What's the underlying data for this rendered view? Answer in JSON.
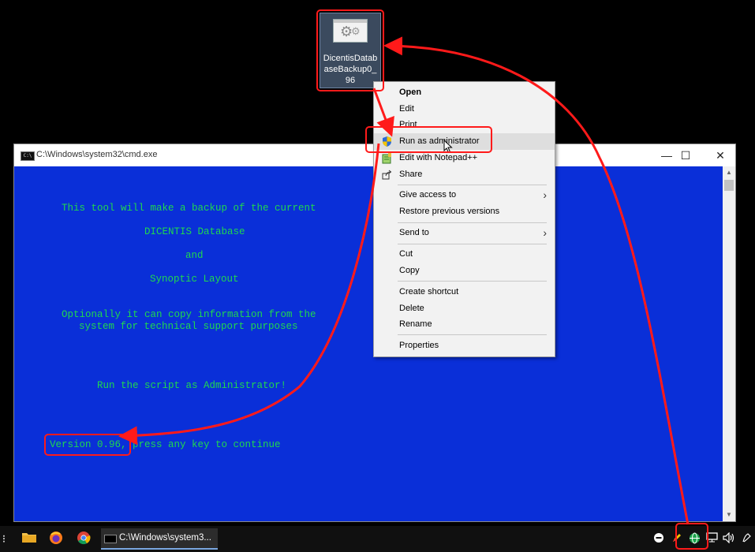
{
  "desktop_icon": {
    "label": "DicentisDatabaseBackup0_96"
  },
  "cmd_window": {
    "title": "C:\\Windows\\system32\\cmd.exe",
    "controls": {
      "minimize": "—",
      "maximize": "☐",
      "close": "✕"
    },
    "lines": [
      "This tool will make a backup of the current",
      "DICENTIS Database",
      "and",
      "Synoptic Layout",
      "Optionally it can copy information from the",
      "system for technical support purposes",
      "Run the script as Administrator!",
      "Version 0.96, press any key to continue"
    ]
  },
  "context_menu": {
    "items": [
      {
        "label": "Open",
        "bold": true
      },
      {
        "label": "Edit"
      },
      {
        "label": "Print"
      },
      {
        "label": "Run as administrator",
        "icon": "uac-shield-icon",
        "highlighted": true
      },
      {
        "label": "Edit with Notepad++",
        "icon": "notepadpp-icon"
      },
      {
        "label": "Share",
        "icon": "share-icon"
      },
      {
        "label": "Give access to",
        "submenu": true
      },
      {
        "label": "Restore previous versions"
      },
      {
        "label": "Send to",
        "submenu": true
      },
      {
        "label": "Cut"
      },
      {
        "label": "Copy"
      },
      {
        "label": "Create shortcut"
      },
      {
        "label": "Delete"
      },
      {
        "label": "Rename"
      },
      {
        "label": "Properties"
      }
    ]
  },
  "taskbar": {
    "task_view_icon": "task-view-icon",
    "pinned": [
      "file-explorer-icon",
      "firefox-icon",
      "chrome-icon"
    ],
    "cmd_task_label": "C:\\Windows\\system3...",
    "tray": [
      "minus-circle-icon",
      "pen-icon",
      "network-globe-icon",
      "display-icon",
      "speaker-icon",
      "ink-icon"
    ]
  },
  "colors": {
    "annotation": "#ff1a1a",
    "cmd_bg": "#0a2fd8",
    "cmd_text": "#1fd84f"
  }
}
